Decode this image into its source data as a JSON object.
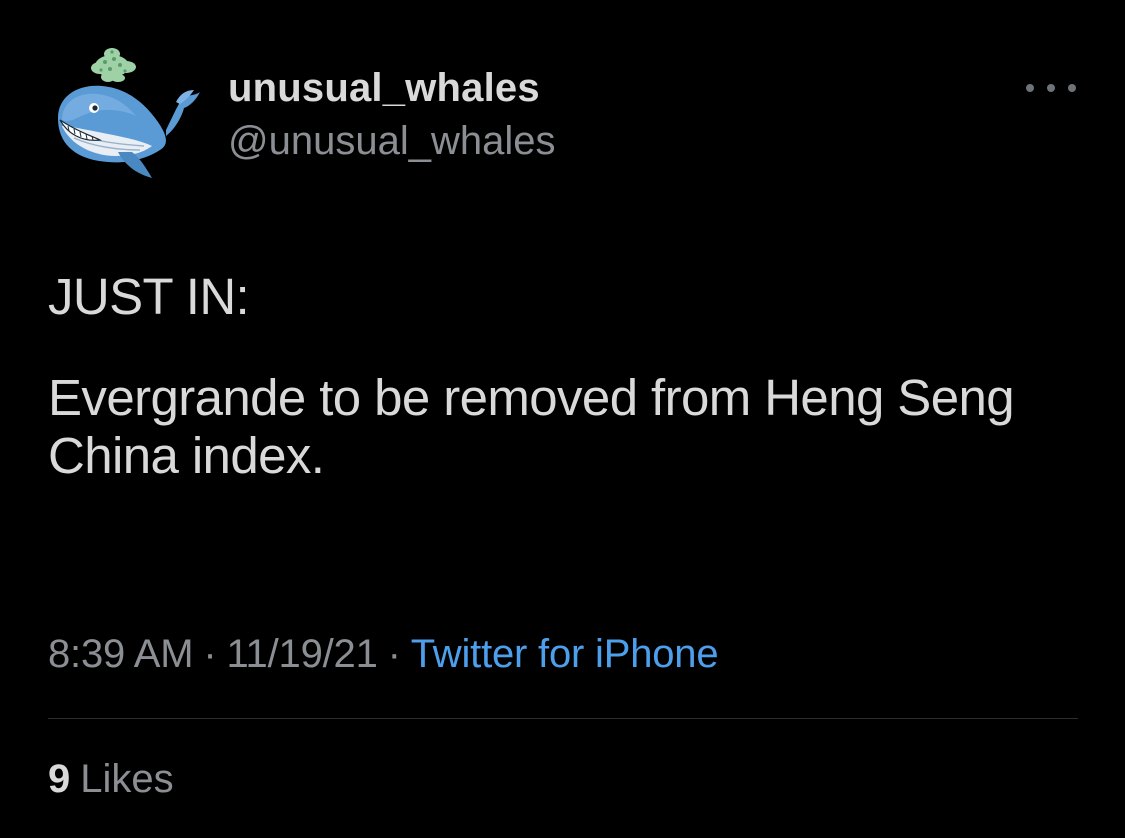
{
  "author": {
    "display_name": "unusual_whales",
    "handle": "@unusual_whales",
    "avatar_icon": "whale-logo-icon"
  },
  "more_icon": "more-options-icon",
  "tweet": {
    "lines": [
      "JUST IN:",
      "Evergrande to be removed from Heng Seng China index."
    ]
  },
  "meta": {
    "time": "8:39 AM",
    "separator": "·",
    "date": "11/19/21",
    "source": "Twitter for iPhone"
  },
  "stats": {
    "likes_count": "9",
    "likes_label": "Likes"
  },
  "colors": {
    "background": "#000000",
    "text_primary": "#d9d9d9",
    "text_secondary": "#8b8f94",
    "link": "#4d9fec",
    "divider": "#2c2f32"
  }
}
